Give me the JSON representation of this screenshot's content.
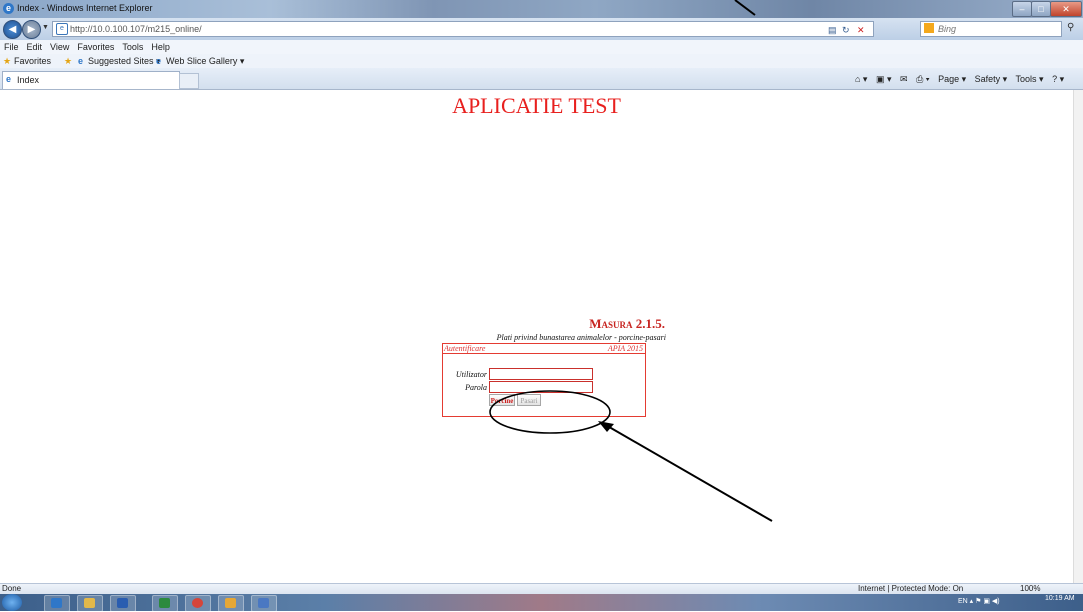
{
  "window": {
    "title": "Index - Windows Internet Explorer",
    "controls": {
      "minimize": "–",
      "maximize": "□",
      "close": "✕"
    }
  },
  "address_bar": {
    "url": "http://10.0.100.107/m215_online/",
    "search_placeholder": "Bing",
    "icons": [
      "refresh-icon",
      "compatibility-icon",
      "stop-icon",
      "search-icon"
    ]
  },
  "menu": [
    "File",
    "Edit",
    "View",
    "Favorites",
    "Tools",
    "Help"
  ],
  "favorites_bar": {
    "favorites_label": "Favorites",
    "suggested_sites": "Suggested Sites ▾",
    "web_slice_gallery": "Web Slice Gallery ▾"
  },
  "tab": {
    "title": "Index"
  },
  "command_bar": {
    "home": "⌂ ▾",
    "feeds": "▣ ▾",
    "mail": "✉",
    "print": "⎙ ▾",
    "page": "Page ▾",
    "safety": "Safety ▾",
    "tools": "Tools ▾",
    "help": "? ▾"
  },
  "page": {
    "title": "APLICATIE TEST",
    "masura": "Masura 2.1.5.",
    "subtitle": "Plati privind bunastarea animalelor - porcine-pasari",
    "auth": {
      "header_left": "Autentificare",
      "header_right": "APIA 2015",
      "user_label": "Utilizator",
      "password_label": "Parola",
      "btn_porcine": "Porcine",
      "btn_pasari": "Pasari"
    }
  },
  "status_bar": {
    "left": "Done",
    "zone": "Internet | Protected Mode: On",
    "zoom": "100%"
  },
  "taskbar": {
    "language": "EN",
    "time": "10:19 AM"
  },
  "colors": {
    "title_red": "#e8201e",
    "masura_red": "#c72420",
    "border_red": "#e43b32",
    "annotation": "#000000"
  }
}
